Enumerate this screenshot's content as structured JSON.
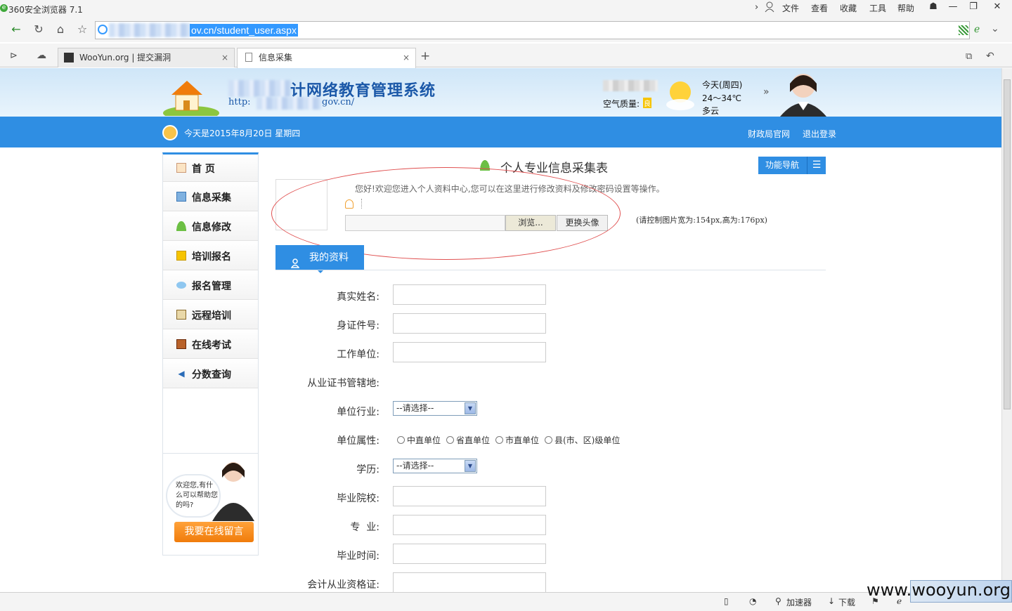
{
  "browser": {
    "title": "360安全浏览器 7.1",
    "menu": [
      "文件",
      "查看",
      "收藏",
      "工具",
      "帮助"
    ],
    "url": "ov.cn/student_user.aspx",
    "tabs": [
      {
        "label": "WooYun.org | 提交漏洞",
        "active": false
      },
      {
        "label": "信息采集",
        "active": true
      }
    ]
  },
  "header": {
    "site_title": "计网络教育管理系统",
    "site_url_prefix": "http:",
    "site_url_suffix": "gov.cn/",
    "air_quality_label": "空气质量:",
    "air_quality_value": "良",
    "weather_day": "今天(周四)",
    "weather_temp": "24～34℃",
    "weather_desc": "多云"
  },
  "bluebar": {
    "date": "今天是2015年8月20日 星期四",
    "link_finance": "财政局官网",
    "link_logout": "退出登录"
  },
  "sidebar": {
    "items": [
      {
        "label": "首 页",
        "icon": "home-icon"
      },
      {
        "label": "信息采集",
        "icon": "info-collect-icon"
      },
      {
        "label": "信息修改",
        "icon": "user-edit-icon"
      },
      {
        "label": "培训报名",
        "icon": "training-signup-icon"
      },
      {
        "label": "报名管理",
        "icon": "chat-icon"
      },
      {
        "label": "远程培训",
        "icon": "remote-training-icon"
      },
      {
        "label": "在线考试",
        "icon": "exam-icon"
      },
      {
        "label": "分数查询",
        "icon": "speaker-icon"
      }
    ],
    "cs_bubble": "欢迎您,有什么可以帮助您的吗?",
    "cs_button": "我要在线留言"
  },
  "main": {
    "form_title": "个人专业信息采集表",
    "func_nav": "功能导航",
    "welcome": "您好!欢迎您进入个人资料中心,您可以在这里进行修改资料及修改密码设置等操作。",
    "browse_button": "浏览...",
    "change_avatar_button": "更换头像",
    "photo_hint": "(请控制图片宽为:154px,高为:176px)",
    "my_info_tab": "我的资料",
    "fields": {
      "real_name": "真实姓名:",
      "id_number": "身证件号:",
      "work_unit": "工作单位:",
      "cert_location": "从业证书管辖地:",
      "industry": "单位行业:",
      "unit_type": "单位属性:",
      "education": "学历:",
      "school": "毕业院校:",
      "major": "专  业:",
      "grad_time": "毕业时间:",
      "qualification": "会计从业资格证:"
    },
    "select_placeholder": "--请选择--",
    "unit_type_options": [
      "中直单位",
      "省直单位",
      "市直单位",
      "县(市、区)级单位"
    ]
  },
  "statusbar": {
    "accelerator": "加速器",
    "download": "下载"
  },
  "watermark": "www.wooyun.org",
  "colors": {
    "accent_blue": "#2f8ee3",
    "title_blue": "#1b58a8",
    "cs_orange": "#f07c0b",
    "highlight_url": "#3399ff"
  }
}
